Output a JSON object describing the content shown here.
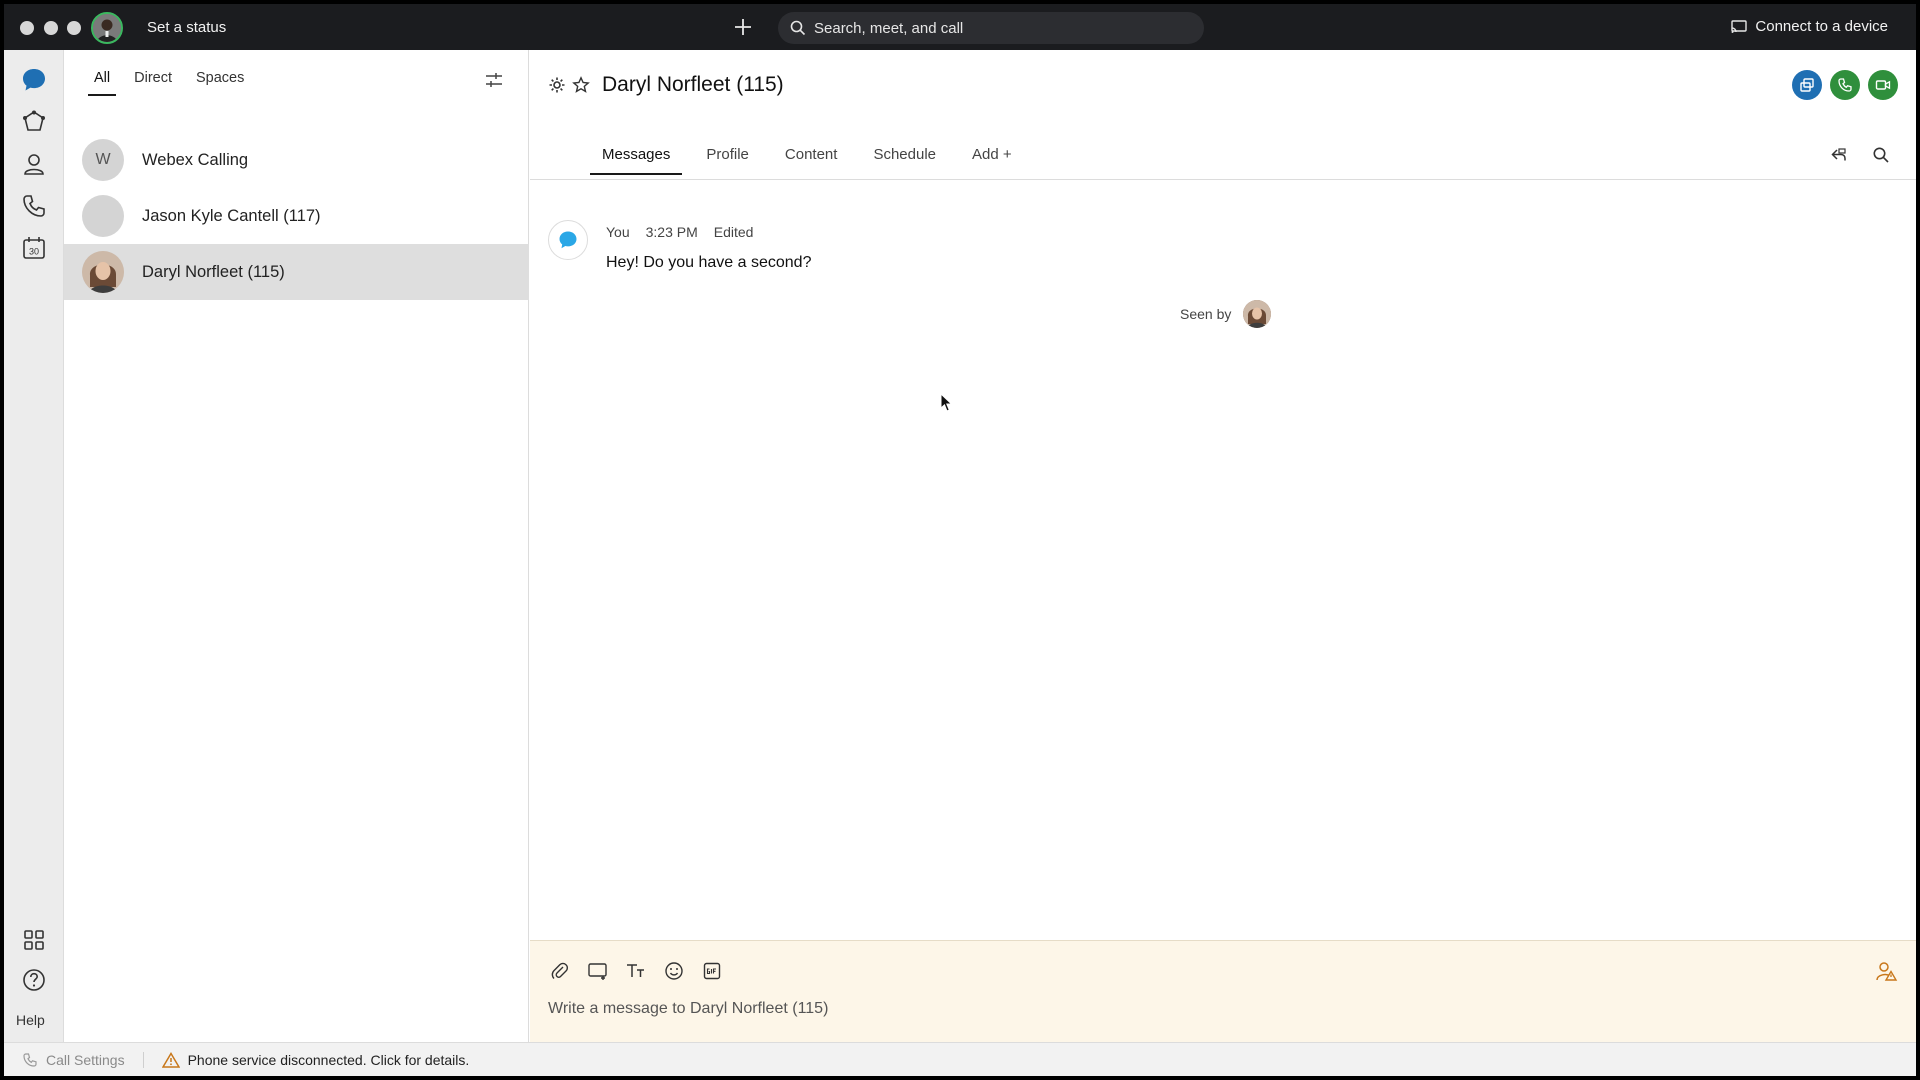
{
  "titlebar": {
    "status_label": "Set a status",
    "search_placeholder": "Search, meet, and call",
    "connect_label": "Connect to a device"
  },
  "rail": {
    "items": [
      {
        "icon": "messaging-icon"
      },
      {
        "icon": "teams-icon"
      },
      {
        "icon": "contacts-icon"
      },
      {
        "icon": "calling-icon"
      },
      {
        "icon": "calendar-icon",
        "label": "30"
      }
    ],
    "help_label": "Help"
  },
  "list": {
    "tabs": [
      {
        "label": "All",
        "active": true
      },
      {
        "label": "Direct"
      },
      {
        "label": "Spaces"
      }
    ],
    "conversations": [
      {
        "name": "Webex Calling",
        "initial": "W"
      },
      {
        "name": "Jason Kyle Cantell (117)",
        "initial": ""
      },
      {
        "name": "Daryl Norfleet (115)",
        "selected": true
      }
    ]
  },
  "chat": {
    "title": "Daryl Norfleet (115)",
    "tabs": [
      {
        "label": "Messages",
        "active": true
      },
      {
        "label": "Profile"
      },
      {
        "label": "Content"
      },
      {
        "label": "Schedule"
      },
      {
        "label": "Add +"
      }
    ],
    "message": {
      "sender": "You",
      "time": "3:23 PM",
      "edited": "Edited",
      "text": "Hey! Do you have a second?"
    },
    "seen_by": "Seen by",
    "composer_placeholder": "Write a message to Daryl Norfleet (115)"
  },
  "statusbar": {
    "call_settings": "Call Settings",
    "phone_warning": "Phone service disconnected. Click for details."
  },
  "colors": {
    "accent_blue": "#1f6fb3",
    "call_green": "#2f8f3c",
    "warning_orange": "#c8771a",
    "message_blue": "#2aa7e6"
  }
}
